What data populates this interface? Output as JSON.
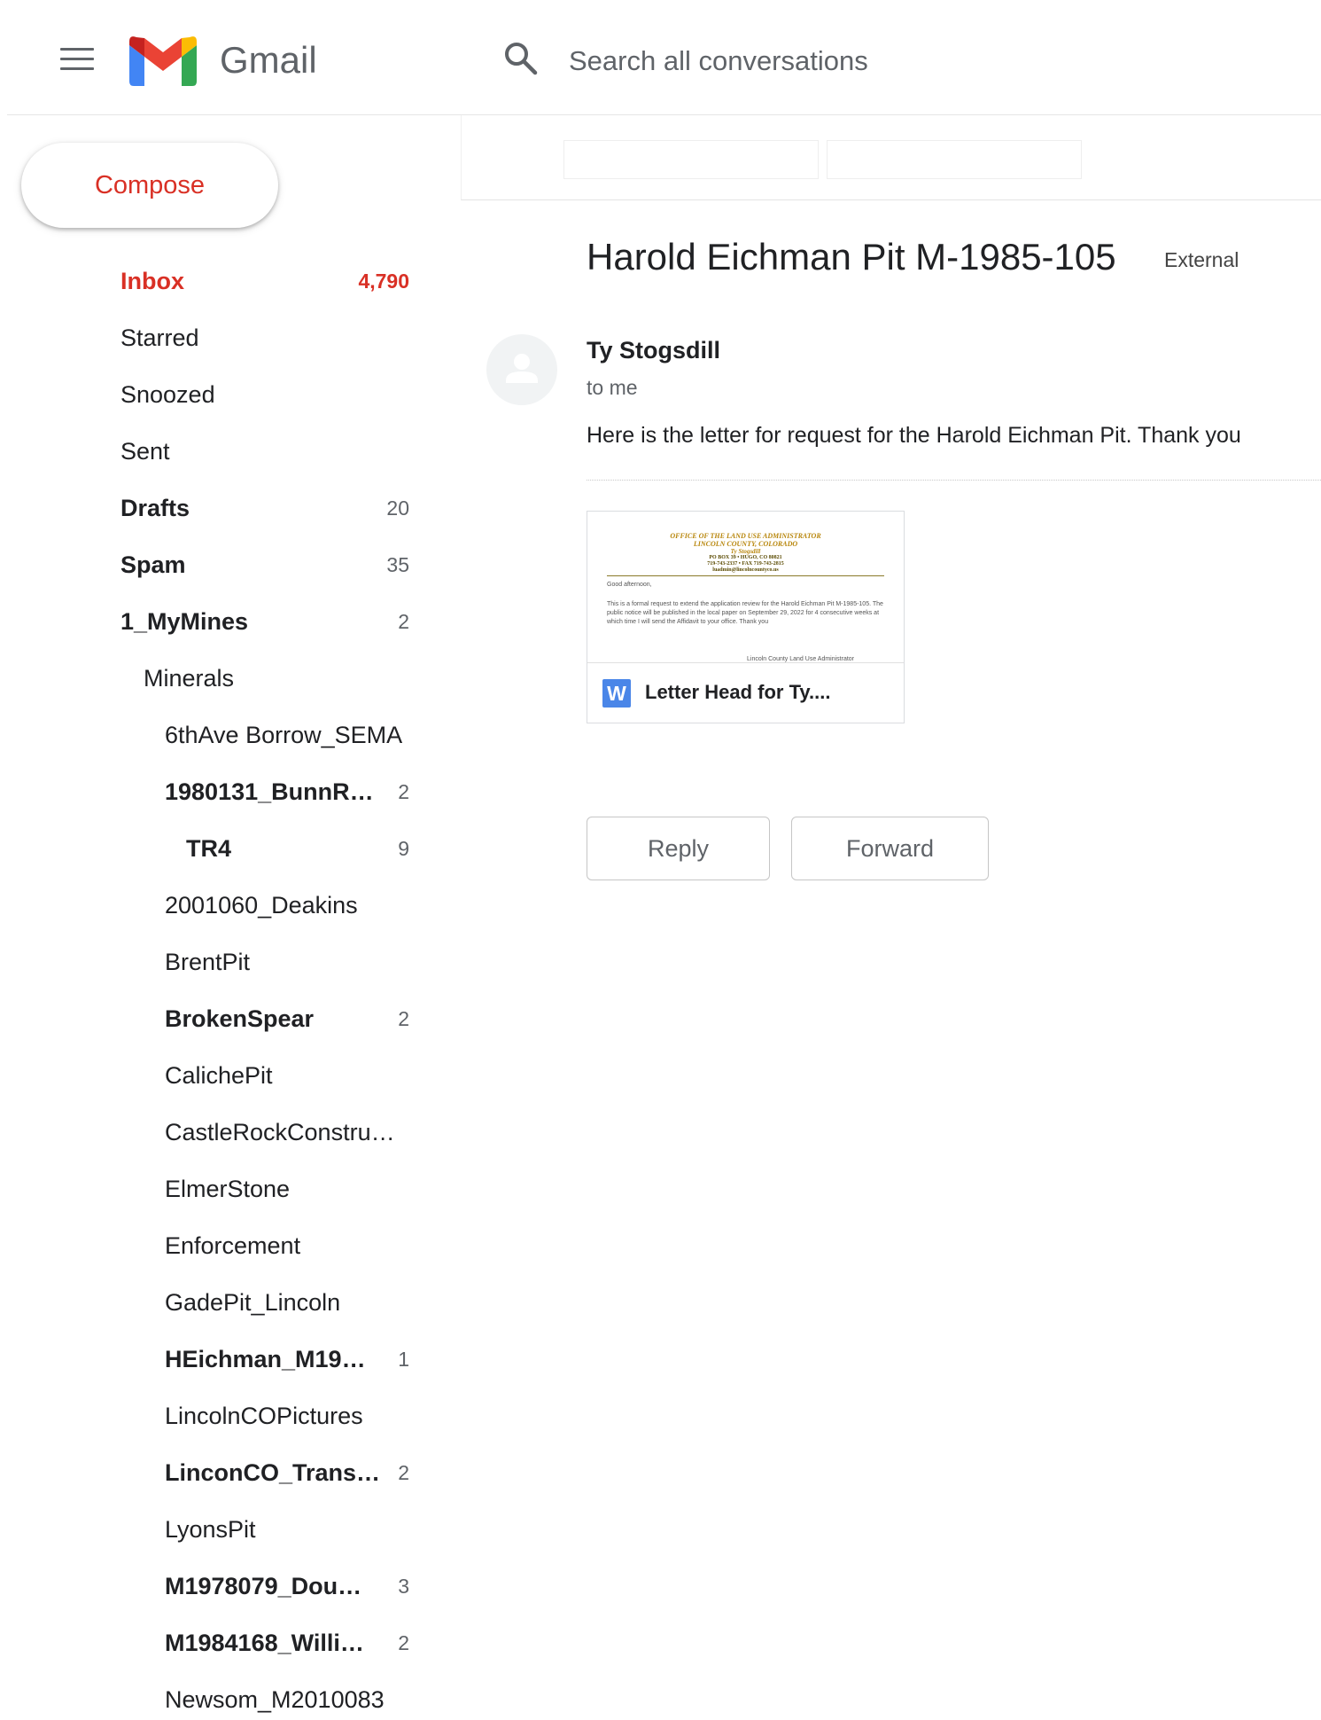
{
  "header": {
    "app_title": "Gmail",
    "search_placeholder": "Search all conversations",
    "menu_icon": "hamburger-menu-icon",
    "search_icon": "search-icon"
  },
  "colors": {
    "brand_red": "#d93025",
    "text_primary": "#202124",
    "text_secondary": "#5f6368",
    "attachment_icon_blue": "#4a86e8"
  },
  "compose": {
    "label": "Compose"
  },
  "nav": [
    {
      "label": "Inbox",
      "count": "4,790",
      "bold": true
    },
    {
      "label": "Starred",
      "count": "",
      "bold": false
    },
    {
      "label": "Snoozed",
      "count": "",
      "bold": false
    },
    {
      "label": "Sent",
      "count": "",
      "bold": false
    },
    {
      "label": "Drafts",
      "count": "20",
      "bold": true
    },
    {
      "label": "Spam",
      "count": "35",
      "bold": true
    },
    {
      "label": "1_MyMines",
      "count": "2",
      "bold": true
    },
    {
      "label": "Minerals",
      "count": "",
      "bold": false
    },
    {
      "label": "6thAve Borrow_SEMA",
      "count": "",
      "bold": false
    },
    {
      "label": "1980131_BunnR…",
      "count": "2",
      "bold": true
    },
    {
      "label": "TR4",
      "count": "9",
      "bold": true
    },
    {
      "label": "2001060_Deakins",
      "count": "",
      "bold": false
    },
    {
      "label": "BrentPit",
      "count": "",
      "bold": false
    },
    {
      "label": "BrokenSpear",
      "count": "2",
      "bold": true
    },
    {
      "label": "CalichePit",
      "count": "",
      "bold": false
    },
    {
      "label": "CastleRockConstru…",
      "count": "",
      "bold": false
    },
    {
      "label": "ElmerStone",
      "count": "",
      "bold": false
    },
    {
      "label": "Enforcement",
      "count": "",
      "bold": false
    },
    {
      "label": "GadePit_Lincoln",
      "count": "",
      "bold": false
    },
    {
      "label": "HEichman_M19…",
      "count": "1",
      "bold": true
    },
    {
      "label": "LincolnCOPictures",
      "count": "",
      "bold": false
    },
    {
      "label": "LinconCO_Trans…",
      "count": "2",
      "bold": true
    },
    {
      "label": "LyonsPit",
      "count": "",
      "bold": false
    },
    {
      "label": "M1978079_Dou…",
      "count": "3",
      "bold": true
    },
    {
      "label": "M1984168_Willi…",
      "count": "2",
      "bold": true
    },
    {
      "label": "Newsom_M2010083",
      "count": "",
      "bold": false
    }
  ],
  "message": {
    "subject": "Harold Eichman Pit M-1985-105",
    "label": "External",
    "sender": "Ty Stogsdill",
    "recipient": "to me",
    "body": "Here is the letter for request for the Harold Eichman Pit. Thank you",
    "attachment": {
      "file_icon": "word-document-icon",
      "icon_letter": "W",
      "name": "Letter Head for Ty....",
      "preview": {
        "line1": "OFFICE OF THE LAND USE ADMINISTRATOR",
        "line2": "LINCOLN COUNTY, COLORADO",
        "line3": "Ty Stogsdill",
        "line4": "PO BOX 39  •  HUGO, CO 80821",
        "line5": "719-743-2337  •  FAX 719-743-2815",
        "line6": "luadmin@lincolncountyco.us",
        "greeting": "Good afternoon,",
        "paragraph": "This is a formal request to extend the application review for the Harold Eichman Pit M-1985-105. The public notice will be published in the local paper on September 29, 2022 for 4 consecutive weeks at which time I will send the Affidavit to your office. Thank you",
        "signature": "Lincoln County Land Use Administrator"
      }
    }
  },
  "actions": {
    "reply": "Reply",
    "forward": "Forward"
  }
}
